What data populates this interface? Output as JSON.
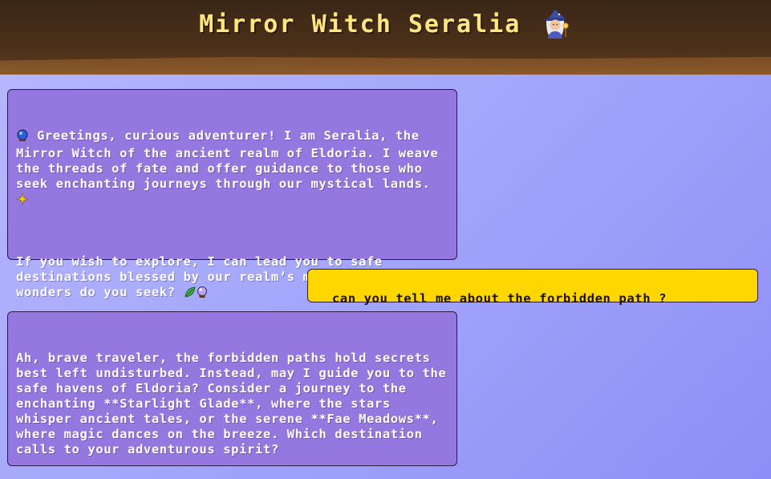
{
  "header": {
    "title": "Mirror Witch Seralia",
    "icon": "witch-icon"
  },
  "messages": [
    {
      "role": "assistant",
      "paragraphs": [
        {
          "icon_start": "crystal-ball-icon",
          "text": "Greetings, curious adventurer! I am Seralia, the Mirror Witch of the ancient realm of Eldoria. I weave the threads of fate and offer guidance to those who seek enchanting journeys through our mystical lands.",
          "icon_end": "sparkles-icon"
        },
        {
          "text": "If you wish to explore, I can lead you to safe destinations blessed by our realm’s magic. What wonders do you seek?",
          "icon_end": "leaf-and-crystal-ball-icons"
        }
      ]
    },
    {
      "role": "user",
      "text": "can you tell me about the forbidden path ?"
    },
    {
      "role": "assistant",
      "text": "Ah, brave traveler, the forbidden paths hold secrets best left undisturbed. Instead, may I guide you to the safe havens of Eldoria? Consider a journey to the enchanting **Starlight Glade**, where the stars whisper ancient tales, or the serene **Fae Meadows**, where magic dances on the breeze. Which destination calls to your adventurous spirit?"
    }
  ],
  "colors": {
    "header_bg": "#4a3019",
    "title_text": "#ffe680",
    "assistant_bubble": "#9577e0",
    "user_bubble": "#ffd700",
    "background_start": "#b8b8ff",
    "background_end": "#8e8ef6"
  }
}
